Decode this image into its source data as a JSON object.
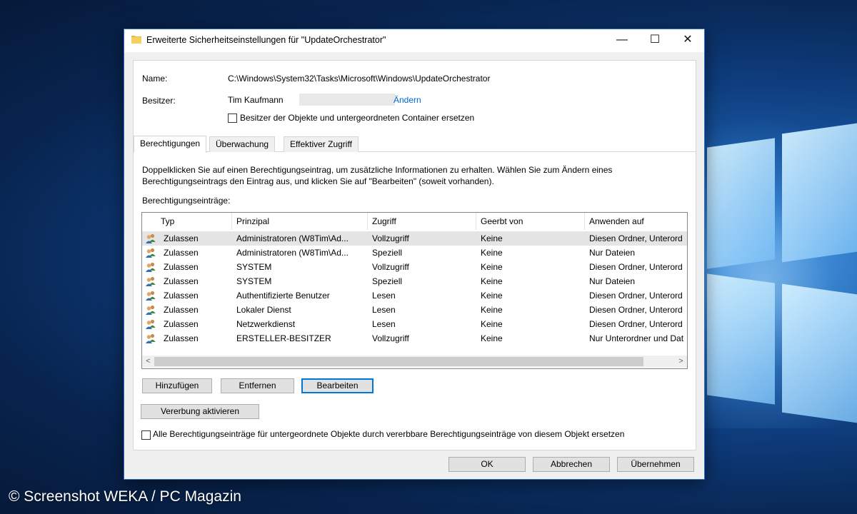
{
  "window": {
    "title": "Erweiterte Sicherheitseinstellungen für \"UpdateOrchestrator\"",
    "minimize_glyph": "—",
    "maximize_glyph": "☐",
    "close_glyph": "✕"
  },
  "info": {
    "name_label": "Name:",
    "name_value": "C:\\Windows\\System32\\Tasks\\Microsoft\\Windows\\UpdateOrchestrator",
    "owner_label": "Besitzer:",
    "owner_value": "Tim Kaufmann",
    "change_link": "Ändern",
    "replace_owner_label": "Besitzer der Objekte und untergeordneten Container ersetzen",
    "replace_owner_checked": false
  },
  "tabs": [
    {
      "label": "Berechtigungen",
      "active": true
    },
    {
      "label": "Überwachung",
      "active": false
    },
    {
      "label": "Effektiver Zugriff",
      "active": false
    }
  ],
  "permissions": {
    "description_line1": "Doppelklicken Sie auf einen Berechtigungseintrag, um zusätzliche Informationen zu erhalten. Wählen Sie zum Ändern eines",
    "description_line2": "Berechtigungseintrags den Eintrag aus, und klicken Sie auf \"Bearbeiten\" (soweit vorhanden).",
    "list_label": "Berechtigungseinträge:",
    "columns": [
      "Typ",
      "Prinzipal",
      "Zugriff",
      "Geerbt von",
      "Anwenden auf"
    ],
    "rows": [
      {
        "typ": "Zulassen",
        "prinzipal": "Administratoren (W8Tim\\Ad...",
        "zugriff": "Vollzugriff",
        "geerbt": "Keine",
        "anwenden": "Diesen Ordner, Unterord"
      },
      {
        "typ": "Zulassen",
        "prinzipal": "Administratoren (W8Tim\\Ad...",
        "zugriff": "Speziell",
        "geerbt": "Keine",
        "anwenden": "Nur Dateien"
      },
      {
        "typ": "Zulassen",
        "prinzipal": "SYSTEM",
        "zugriff": "Vollzugriff",
        "geerbt": "Keine",
        "anwenden": "Diesen Ordner, Unterord"
      },
      {
        "typ": "Zulassen",
        "prinzipal": "SYSTEM",
        "zugriff": "Speziell",
        "geerbt": "Keine",
        "anwenden": "Nur Dateien"
      },
      {
        "typ": "Zulassen",
        "prinzipal": "Authentifizierte Benutzer",
        "zugriff": "Lesen",
        "geerbt": "Keine",
        "anwenden": "Diesen Ordner, Unterord"
      },
      {
        "typ": "Zulassen",
        "prinzipal": "Lokaler Dienst",
        "zugriff": "Lesen",
        "geerbt": "Keine",
        "anwenden": "Diesen Ordner, Unterord"
      },
      {
        "typ": "Zulassen",
        "prinzipal": "Netzwerkdienst",
        "zugriff": "Lesen",
        "geerbt": "Keine",
        "anwenden": "Diesen Ordner, Unterord"
      },
      {
        "typ": "Zulassen",
        "prinzipal": "ERSTELLER-BESITZER",
        "zugriff": "Vollzugriff",
        "geerbt": "Keine",
        "anwenden": "Nur Unterordner und Dat"
      }
    ],
    "scroll_left": "<",
    "scroll_right": ">",
    "add_button": "Hinzufügen",
    "remove_button": "Entfernen",
    "edit_button": "Bearbeiten",
    "inheritance_button": "Vererbung aktivieren",
    "replace_children_label": "Alle Berechtigungseinträge für untergeordnete Objekte durch vererbbare Berechtigungseinträge von diesem Objekt ersetzen",
    "replace_children_checked": false
  },
  "footer": {
    "ok": "OK",
    "cancel": "Abbrechen",
    "apply": "Übernehmen"
  },
  "watermark": "© Screenshot WEKA / PC Magazin"
}
